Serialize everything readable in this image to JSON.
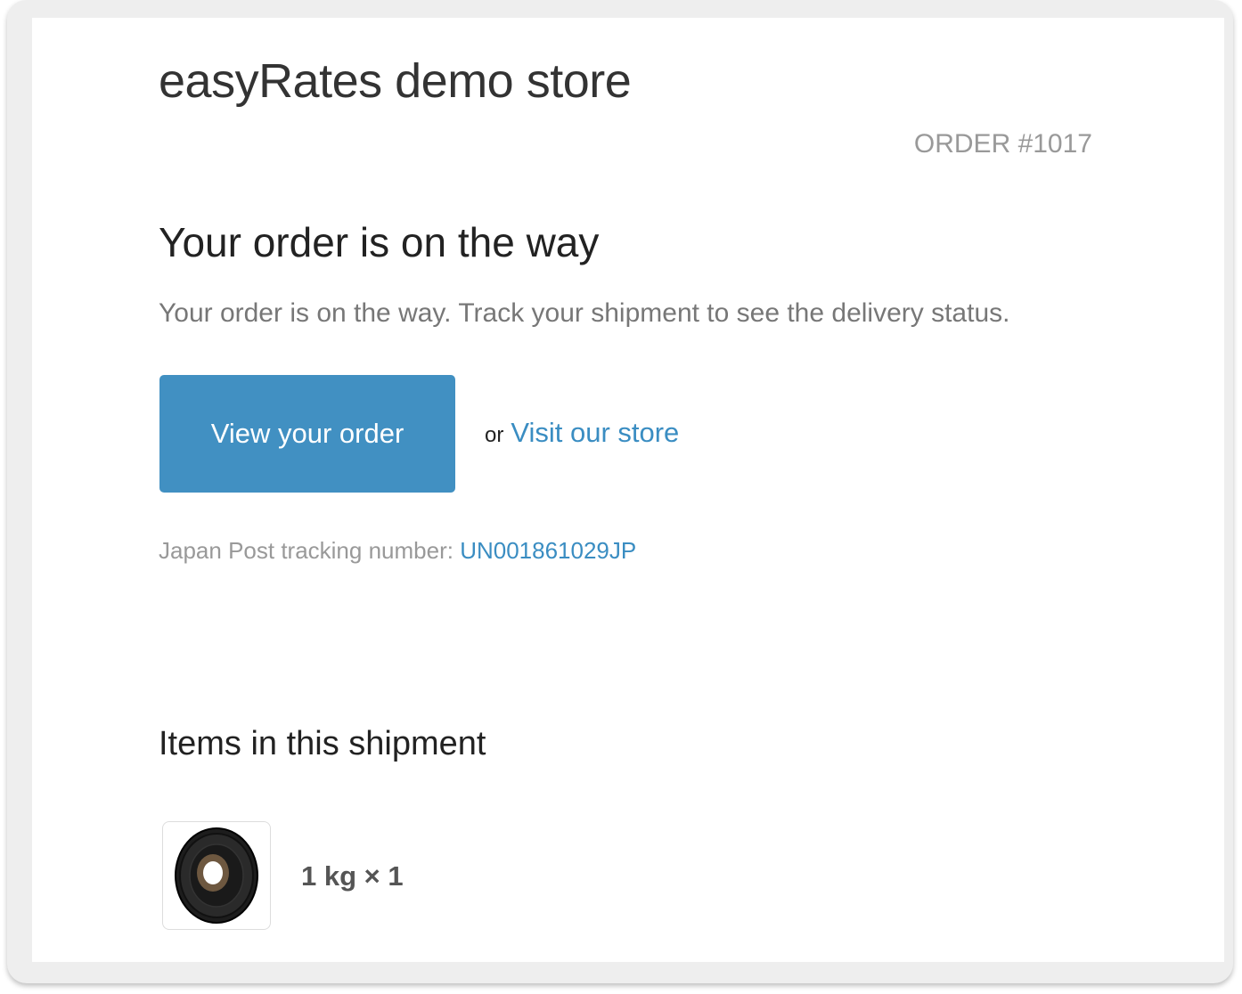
{
  "shop": {
    "name": "easyRates demo store",
    "order_number": "ORDER #1017"
  },
  "notification": {
    "heading": "Your order is on the way",
    "message": "Your order is on the way. Track your shipment to see the delivery status."
  },
  "actions": {
    "view_order_label": "View your order",
    "or_text": "or",
    "visit_store_label": "Visit our store"
  },
  "tracking": {
    "label": "Japan Post tracking number:",
    "number": "UN001861029JP"
  },
  "shipment": {
    "heading": "Items in this shipment",
    "items": [
      {
        "title": "1 kg × 1",
        "image_icon": "weight-plate-image"
      }
    ]
  },
  "colors": {
    "button": "#4190c2",
    "link": "#3a8dc2",
    "muted_text": "#999999"
  }
}
